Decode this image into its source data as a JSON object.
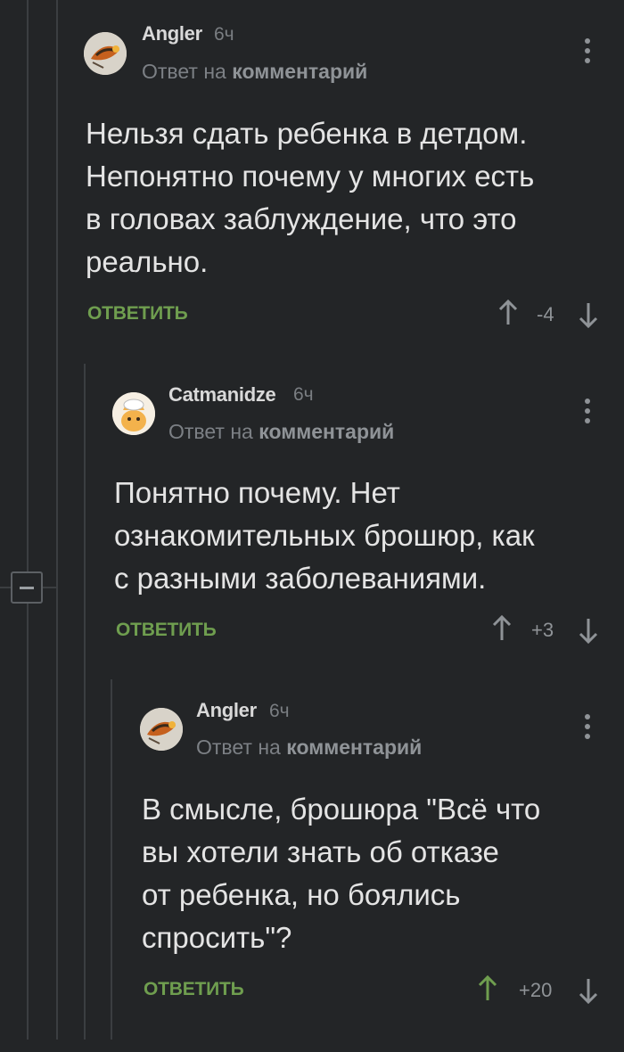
{
  "comments": [
    {
      "username": "Angler",
      "time": "6ч",
      "reply_prefix": "Ответ на",
      "reply_target": "комментарий",
      "lines": [
        "Нельзя сдать ребенка в детдом.",
        "Непонятно почему у многих есть",
        "в головах заблуждение, что это",
        "реально."
      ],
      "reply_label": "ОТВЕТИТЬ",
      "rating": "-4",
      "upvoted": false
    },
    {
      "username": "Catmanidze",
      "time": "6ч",
      "reply_prefix": "Ответ на",
      "reply_target": "комментарий",
      "lines": [
        "Понятно почему. Нет",
        "ознакомительных брошюр, как",
        "с разными заболеваниями."
      ],
      "reply_label": "ОТВЕТИТЬ",
      "rating": "+3",
      "upvoted": false
    },
    {
      "username": "Angler",
      "time": "6ч",
      "reply_prefix": "Ответ на",
      "reply_target": "комментарий",
      "lines": [
        "В смысле, брошюра \"Всё что",
        "вы хотели знать об отказе",
        "от ребенка, но боялись",
        "спросить\"?"
      ],
      "reply_label": "ОТВЕТИТЬ",
      "rating": "+20",
      "upvoted": true
    }
  ],
  "colors": {
    "background": "#232527",
    "reply_button": "#6f9e4f",
    "upvote_active": "#6f9e4f",
    "muted": "#8f9397"
  }
}
